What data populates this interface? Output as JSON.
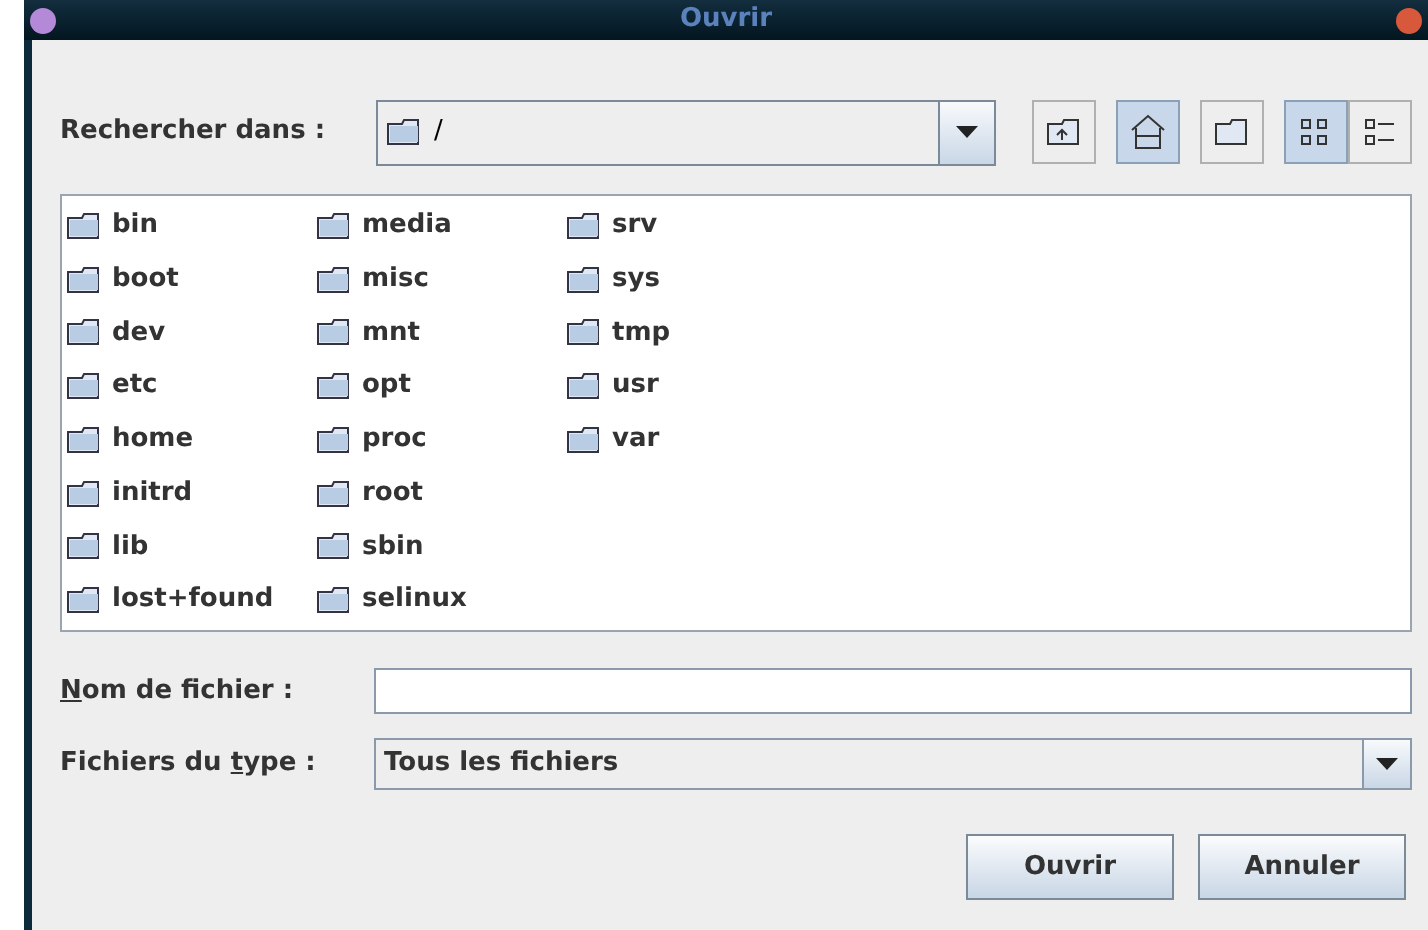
{
  "window": {
    "title": "Ouvrir"
  },
  "look_in": {
    "label": "Rechercher dans :",
    "value": "/"
  },
  "toolbar": [
    {
      "kind": "up",
      "selected": false
    },
    {
      "kind": "home",
      "selected": true
    },
    {
      "kind": "new-folder",
      "selected": false
    },
    {
      "kind": "list",
      "selected": true
    },
    {
      "kind": "details",
      "selected": false
    }
  ],
  "files": [
    "bin",
    "boot",
    "dev",
    "etc",
    "home",
    "initrd",
    "lib",
    "lost+found",
    "media",
    "misc",
    "mnt",
    "opt",
    "proc",
    "root",
    "sbin",
    "selinux",
    "srv",
    "sys",
    "tmp",
    "usr",
    "var"
  ],
  "file_name": {
    "label": [
      {
        "text": "N",
        "underlined": true
      },
      {
        "text": "om de fichier :",
        "underlined": false
      }
    ]
  },
  "file_type": {
    "label": [
      {
        "text": "Fichiers du ",
        "underlined": false
      },
      {
        "text": "t",
        "underlined": true
      },
      {
        "text": "ype :",
        "underlined": false
      }
    ],
    "value": "Tous les fichiers"
  },
  "buttons": [
    "Ouvrir",
    "Annuler"
  ]
}
